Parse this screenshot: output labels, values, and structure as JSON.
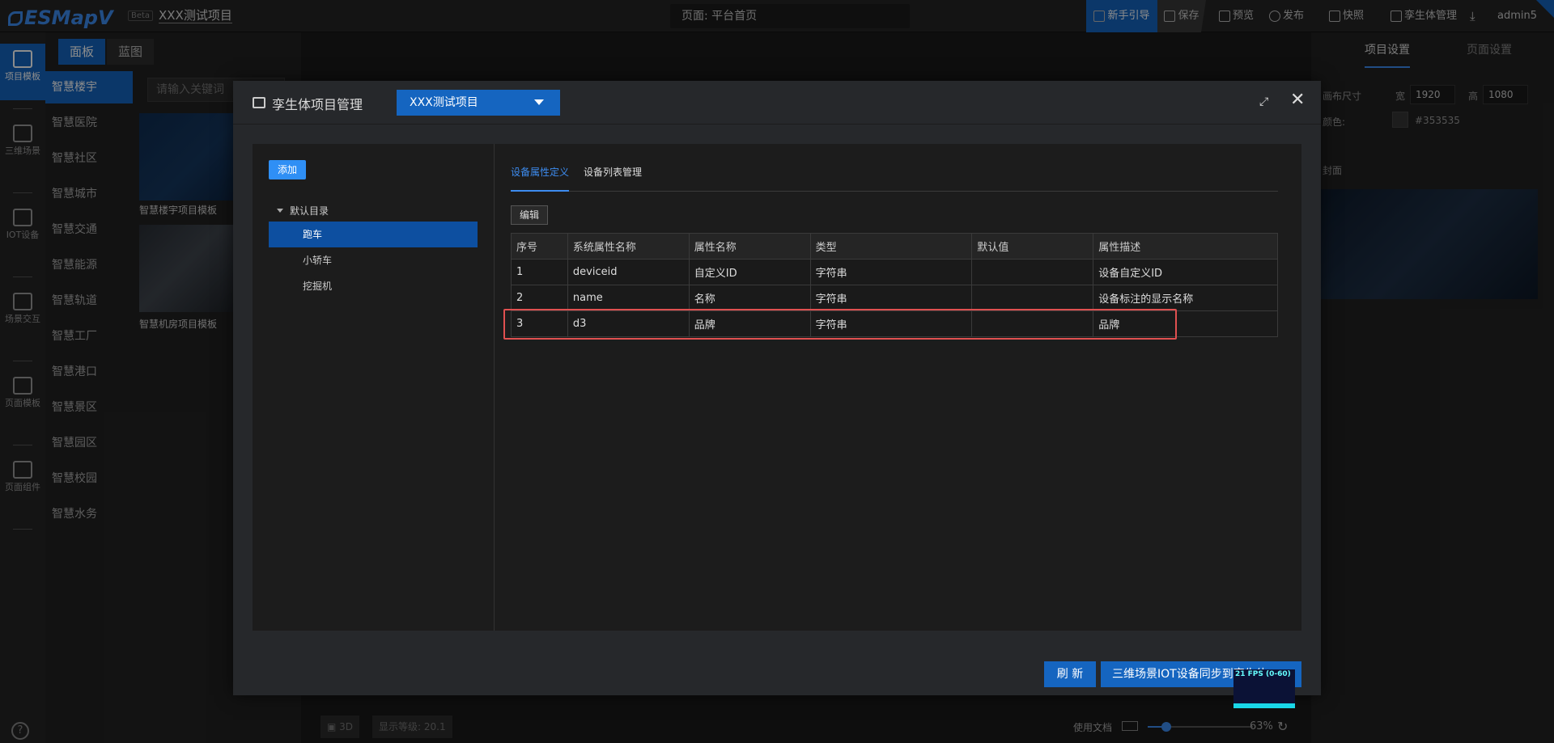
{
  "app": {
    "logo": "ESMapV",
    "beta": "Beta",
    "project_name": "XXX测试项目",
    "page_selector": "页面: 平台首页"
  },
  "toolbar": {
    "guide": "新手引导",
    "save": "保存",
    "preview": "预览",
    "publish": "发布",
    "snapshot": "快照",
    "twin_manage": "孪生体管理",
    "user": "admin5"
  },
  "leftbar": [
    {
      "label": "项目模板",
      "icon": "project-template-icon"
    },
    {
      "label": "三维场景",
      "icon": "building-icon"
    },
    {
      "label": "IOT设备",
      "icon": "cube-icon"
    },
    {
      "label": "场景交互",
      "icon": "sliders-icon"
    },
    {
      "label": "页面模板",
      "icon": "page-template-icon"
    },
    {
      "label": "页面组件",
      "icon": "grid-icon"
    }
  ],
  "panel": {
    "tabs": [
      "面板",
      "蓝图"
    ],
    "search_placeholder": "请输入关键词",
    "categories": [
      "智慧楼宇",
      "智慧医院",
      "智慧社区",
      "智慧城市",
      "智慧交通",
      "智慧能源",
      "智慧轨道",
      "智慧工厂",
      "智慧港口",
      "智慧景区",
      "智慧园区",
      "智慧校园",
      "智慧水务"
    ],
    "templates": [
      "智慧楼宇项目模板",
      "智慧机房项目模板"
    ]
  },
  "right": {
    "tabs": [
      "项目设置",
      "页面设置"
    ],
    "canvas_size_label": "画布尺寸",
    "width_label": "宽",
    "width": "1920",
    "height_label": "高",
    "height": "1080",
    "color_label": "颜色:",
    "color": "#353535",
    "cover_label": "封面"
  },
  "bottom": {
    "mode": "3D",
    "display_level": "显示等级: 20.1",
    "docs": "使用文档",
    "zoom": "63%"
  },
  "modal": {
    "title": "孪生体项目管理",
    "project": "XXX测试项目",
    "add": "添加",
    "root": "默认目录",
    "nodes": [
      "跑车",
      "小轿车",
      "挖掘机"
    ],
    "tabs": [
      "设备属性定义",
      "设备列表管理"
    ],
    "edit": "编辑",
    "columns": [
      "序号",
      "系统属性名称",
      "属性名称",
      "类型",
      "默认值",
      "属性描述"
    ],
    "rows": [
      [
        "1",
        "deviceid",
        "自定义ID",
        "字符串",
        "",
        "设备自定义ID"
      ],
      [
        "2",
        "name",
        "名称",
        "字符串",
        "",
        "设备标注的显示名称"
      ],
      [
        "3",
        "d3",
        "品牌",
        "字符串",
        "",
        "品牌"
      ]
    ],
    "refresh": "刷 新",
    "sync": "三维场景IOT设备同步到孪生体"
  },
  "fps": "21 FPS (0-60)",
  "colors": {
    "accent": "#1565c0",
    "highlight": "#e05050"
  }
}
